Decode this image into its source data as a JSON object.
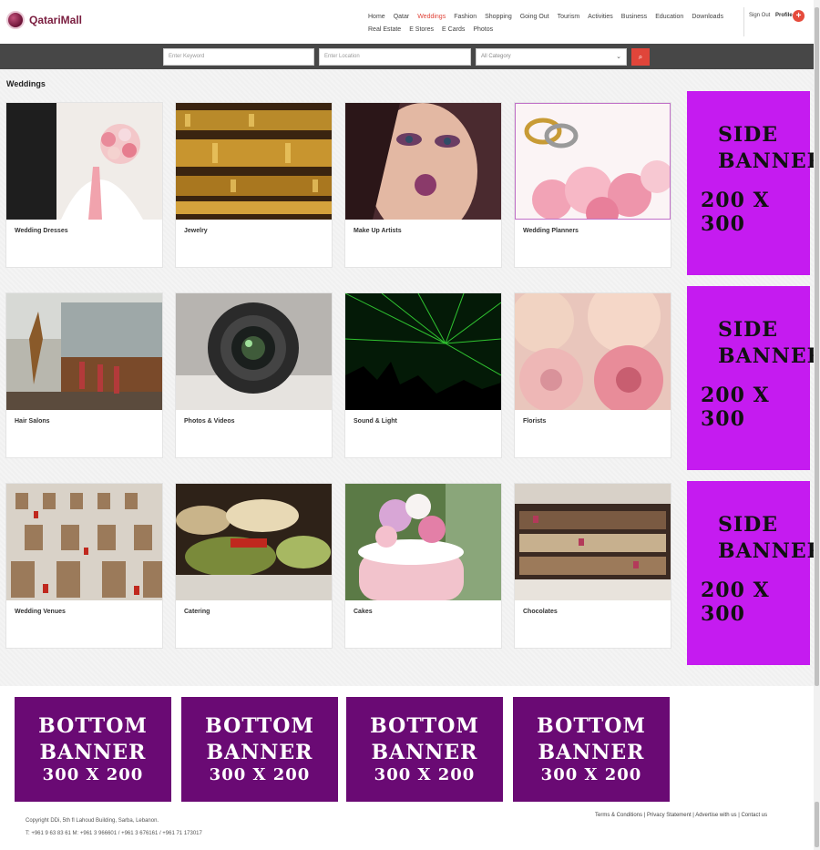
{
  "header": {
    "logo_text": "QatariMall",
    "nav": [
      "Home",
      "Qatar",
      "Weddings",
      "Fashion",
      "Shopping",
      "Going Out",
      "Tourism",
      "Activities",
      "Business",
      "Education",
      "Downloads",
      "Real Estate",
      "E Stores",
      "E Cards",
      "Photos"
    ],
    "active_nav": "Weddings",
    "sign_out": "Sign Out",
    "profile": "Profile",
    "profile_icon": "+"
  },
  "search": {
    "keyword_placeholder": "Enter Keyword",
    "location_placeholder": "Enter Location",
    "category_selected": "All Category",
    "search_icon": "⌕"
  },
  "page": {
    "title": "Weddings"
  },
  "categories": [
    "Wedding Dresses",
    "Jewelry",
    "Make Up Artists",
    "Wedding Planners",
    "Hair Salons",
    "Photos & Videos",
    "Sound & Light",
    "Florists",
    "Wedding Venues",
    "Catering",
    "Cakes",
    "Chocolates"
  ],
  "side_banner": {
    "line1": "SIDE\nBANNER",
    "line2": "200 X 300",
    "color": "#c51bf0"
  },
  "bottom_banner": {
    "line1": "BOTTOM\nBANNER",
    "line2": "300 X 200",
    "color": "#6a0a74"
  },
  "footer": {
    "copyright": "Copyright DDi, 5th fl Lahoud Building, Sarba, Lebanon.",
    "phones": "T: +961 9 63 83 61 M: +961 3 966601 / +961 3 676161 / +961 71 173017",
    "links": [
      "Terms & Conditions",
      "Privacy Statement",
      "Advertise with us",
      "Contact us"
    ]
  },
  "colors": {
    "accent": "#e0453a",
    "searchbar": "#474747"
  }
}
